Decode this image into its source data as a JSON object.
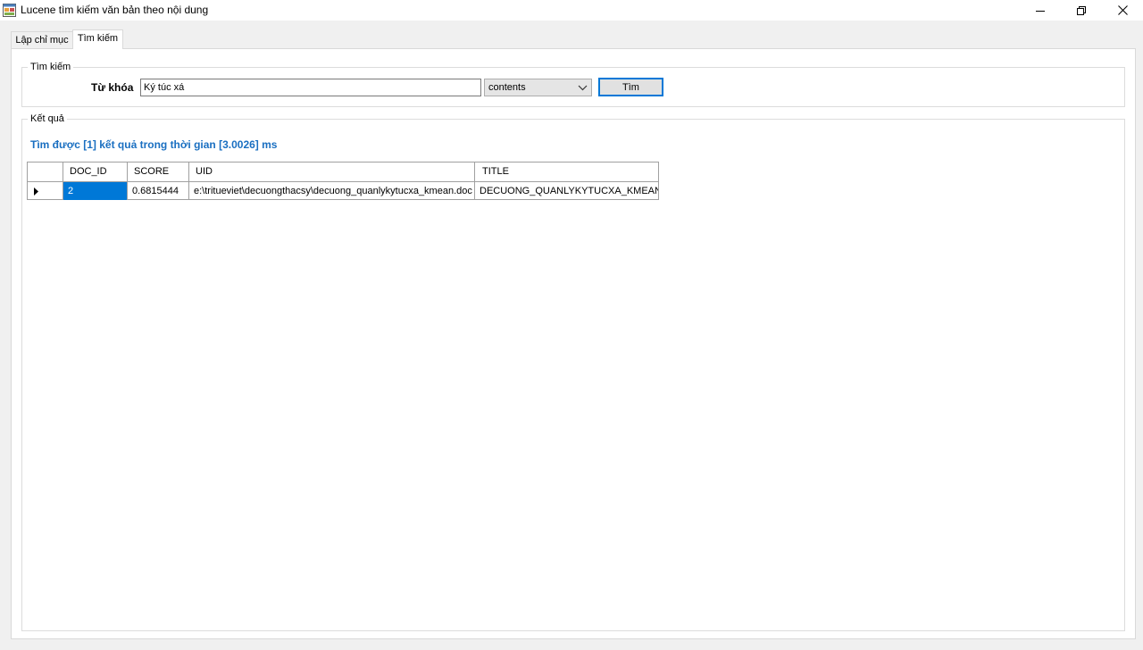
{
  "window": {
    "title": "Lucene tìm kiếm văn bản theo nội dung",
    "icon": "application-form-icon",
    "controls": [
      "minimize-icon",
      "restore-icon",
      "close-icon"
    ]
  },
  "tabs": [
    {
      "label": "Lập chỉ mục",
      "active": false
    },
    {
      "label": "Tìm kiếm",
      "active": true
    }
  ],
  "search_group": {
    "title": "Tìm kiếm",
    "keyword_label": "Từ khóa",
    "keyword_value": "Ký túc xá",
    "field_selected": "contents",
    "search_button": "Tìm"
  },
  "result_group": {
    "title": "Kết quả",
    "summary": "Tìm được [1] kết quả trong thời gian [3.0026] ms",
    "summary_color": "#1a6fc1"
  },
  "grid": {
    "columns": [
      "DOC_ID",
      "SCORE",
      "UID",
      "TITLE"
    ],
    "rows": [
      {
        "doc_id": "2",
        "score": "0.6815444",
        "uid": "e:\\tritueviet\\decuongthacsy\\decuong_quanlykytucxa_kmean.doc",
        "title": "DECUONG_QUANLYKYTUCXA_KMEAN"
      }
    ],
    "selection_color": "#0078d7"
  }
}
